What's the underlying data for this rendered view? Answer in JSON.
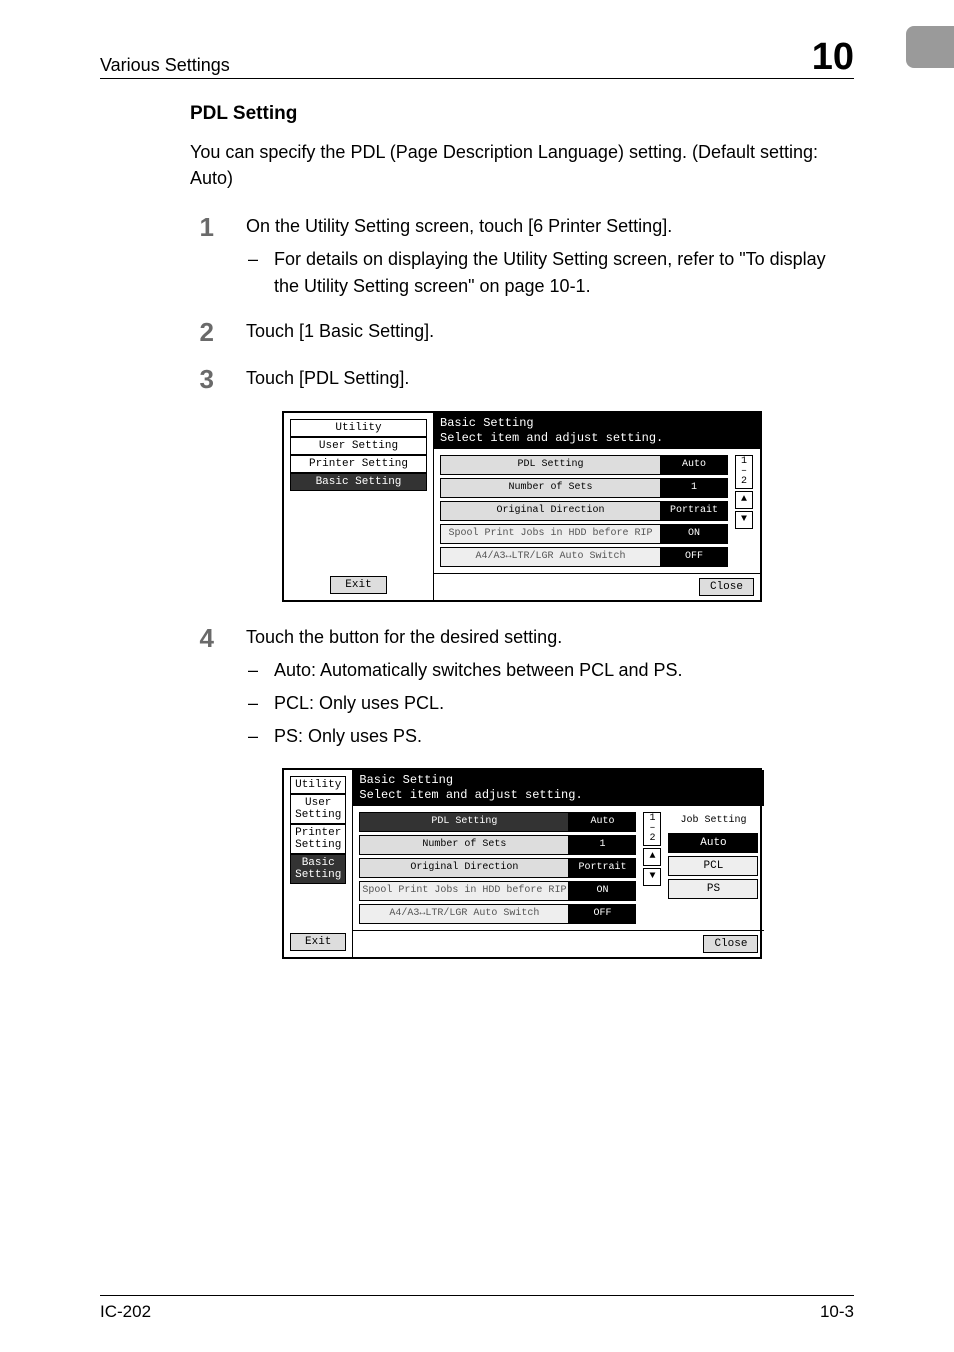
{
  "header": {
    "section": "Various Settings",
    "chapter": "10"
  },
  "heading": "PDL Setting",
  "intro": "You can specify the PDL (Page Description Language) setting. (Default setting: Auto)",
  "steps": {
    "s1": {
      "num": "1",
      "text": "On the Utility Setting screen, touch [6 Printer Setting].",
      "sub1": "For details on displaying the Utility Setting screen, refer to \"To display the Utility Setting screen\" on page 10-1."
    },
    "s2": {
      "num": "2",
      "text": "Touch [1 Basic Setting]."
    },
    "s3": {
      "num": "3",
      "text": "Touch [PDL Setting]."
    },
    "s4": {
      "num": "4",
      "text": "Touch the button for the desired setting.",
      "sub1": "Auto: Automatically switches between PCL and PS.",
      "sub2": "PCL: Only uses PCL.",
      "sub3": "PS: Only uses PS."
    }
  },
  "panel": {
    "title_line1": "Basic Setting",
    "title_line2": "Select item and adjust setting.",
    "crumbs": {
      "c1": "Utility",
      "c2": "User Setting",
      "c3": "Printer Setting",
      "c4": "Basic Setting"
    },
    "exit": "Exit",
    "rows": {
      "r1": {
        "label": "PDL Setting",
        "value": "Auto"
      },
      "r2": {
        "label": "Number of Sets",
        "value": "1"
      },
      "r3": {
        "label": "Original Direction",
        "value": "Portrait"
      },
      "r4": {
        "label": "Spool Print Jobs in HDD before RIP",
        "value": "ON"
      },
      "r5": {
        "label": "A4/A3↔LTR/LGR Auto Switch",
        "value": "OFF"
      }
    },
    "page_indicator_top": "1",
    "page_indicator_bottom": "2",
    "close": "Close",
    "options": {
      "title": "Job Setting",
      "o1": "Auto",
      "o2": "PCL",
      "o3": "PS"
    }
  },
  "footer": {
    "left": "IC-202",
    "right": "10-3"
  }
}
